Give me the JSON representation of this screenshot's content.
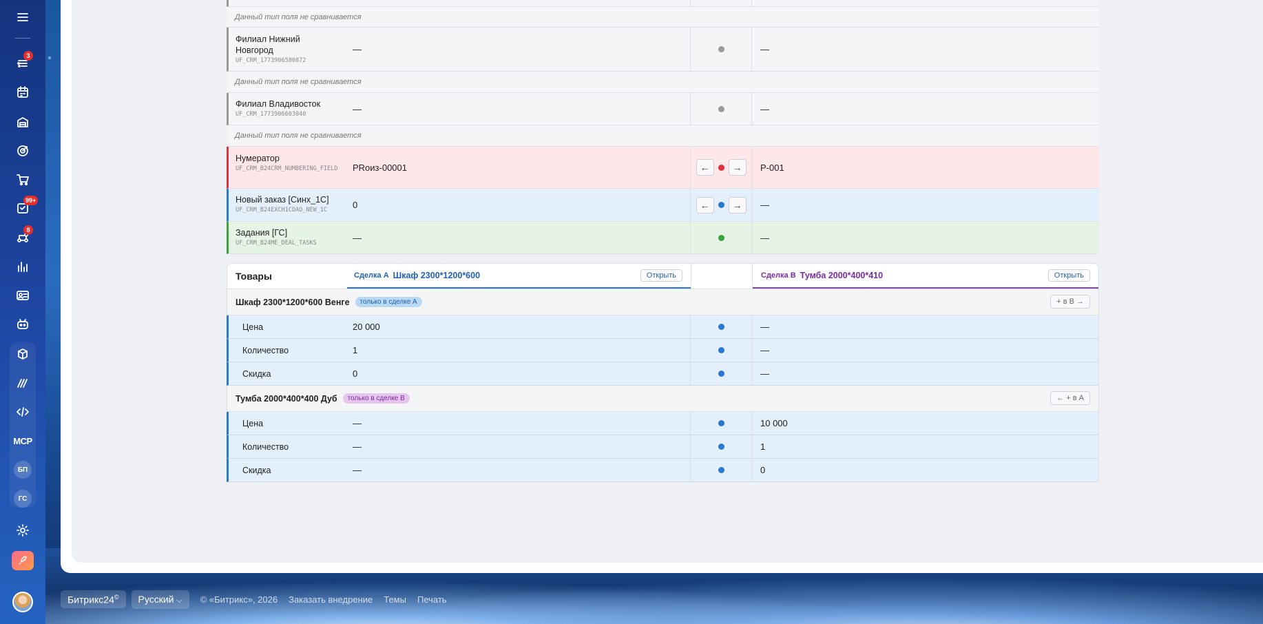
{
  "sidebar": {
    "badges": {
      "feed": "3",
      "tasks": "99+",
      "automation": "8"
    },
    "text_items": [
      "MCP",
      "БП",
      "ГС"
    ]
  },
  "fields": [
    {
      "name": "",
      "code": "",
      "a": "",
      "b": ""
    },
    {
      "note": "Данный тип поля не сравнивается"
    },
    {
      "name": "Филиал Нижний Новгород",
      "code": "UF_CRM_1773906580872",
      "a": "—",
      "b": "—"
    },
    {
      "note": "Данный тип поля не сравнивается"
    },
    {
      "name": "Филиал Владивосток",
      "code": "UF_CRM_1773906603040",
      "a": "—",
      "b": "—"
    },
    {
      "note": "Данный тип поля не сравнивается"
    },
    {
      "name": "Нумератор",
      "code": "UF_CRM_B24CRM_NUMBERING_FIELD",
      "a": "PRоиз-00001",
      "b": "P-001"
    },
    {
      "name": "Новый заказ [Синх_1С]",
      "code": "UF_CRM_B24EXCH1CDAO_NEW_1C",
      "a": "0",
      "b": "—"
    },
    {
      "name": "Задания [ГС]",
      "code": "UF_CRM_B24ME_DEAL_TASKS",
      "a": "—",
      "b": "—"
    }
  ],
  "arrows": {
    "left": "←",
    "right": "→"
  },
  "products": {
    "title": "Товары",
    "deal_a_label": "Сделка А",
    "deal_a_name": "Шкаф 2300*1200*600",
    "deal_b_label": "Сделка B",
    "deal_b_name": "Тумба 2000*400*410",
    "open_label": "Открыть",
    "groups": [
      {
        "name": "Шкаф 2300*1200*600 Венге",
        "tag": "только в сделке А",
        "action": "+ в B →",
        "rows": [
          {
            "label": "Цена",
            "a": "20 000",
            "b": "—"
          },
          {
            "label": "Количество",
            "a": "1",
            "b": "—"
          },
          {
            "label": "Скидка",
            "a": "0",
            "b": "—"
          }
        ]
      },
      {
        "name": "Тумба 2000*400*400 Дуб",
        "tag": "только в сделке B",
        "action": "← + в А",
        "rows": [
          {
            "label": "Цена",
            "a": "—",
            "b": "10 000"
          },
          {
            "label": "Количество",
            "a": "—",
            "b": "1"
          },
          {
            "label": "Скидка",
            "a": "—",
            "b": "0"
          }
        ]
      }
    ]
  },
  "footer": {
    "brand": "Битрикс24",
    "brand_mark": "©",
    "language": "Русский",
    "copyright": "© «Битрикс», 2026",
    "links": [
      "Заказать внедрение",
      "Темы",
      "Печать"
    ]
  },
  "colors": {
    "sidebar": "#1a3f92",
    "conflict_bg": "#fde7e9",
    "conflict_border": "#e0303e",
    "info_bg": "#e3effb",
    "info_border": "#2a78d6",
    "same_bg": "#e5f4e5",
    "same_border": "#3da43d",
    "neutral_dot": "#9a9a9a",
    "deal_a": "#2061b8",
    "deal_b": "#7a2aa8"
  }
}
